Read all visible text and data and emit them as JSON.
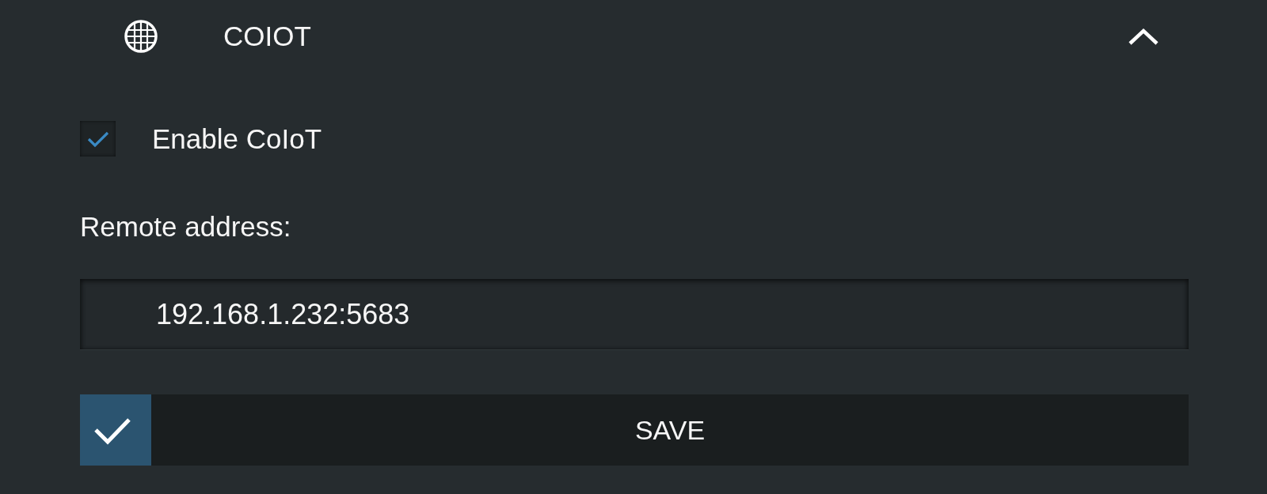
{
  "section": {
    "title": "COIOT",
    "expanded": true
  },
  "settings": [
    {
      "kind": "checkbox",
      "label": "Enable CoIoT",
      "checked": true
    }
  ],
  "remote": {
    "label": "Remote address:",
    "value": "192.168.1.232:5683"
  },
  "save_button": {
    "label": "SAVE"
  }
}
